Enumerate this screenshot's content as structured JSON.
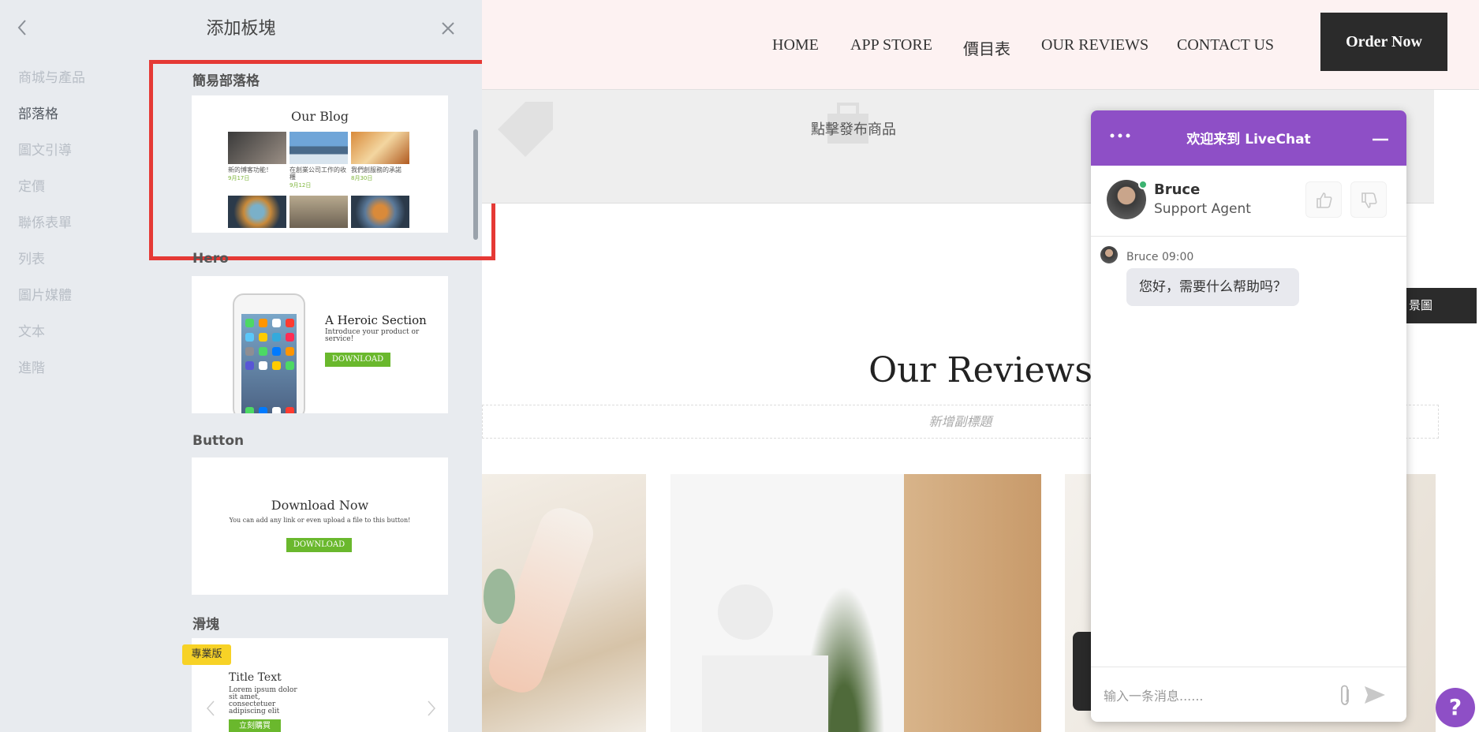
{
  "panel": {
    "title": "添加板塊",
    "categories": [
      "商城与產品",
      "部落格",
      "圖文引導",
      "定價",
      "聯係表單",
      "列表",
      "圖片媒體",
      "文本",
      "進階"
    ],
    "active_category": "部落格"
  },
  "blocks": {
    "blog": {
      "title": "簡易部落格",
      "preview_heading": "Our Blog",
      "captions": [
        "新的博客功能！",
        "在創業公司工作的收穫",
        "我們創服務的承諾"
      ],
      "dates": [
        "9月17日",
        "9月12日",
        "8月30日"
      ]
    },
    "hero": {
      "title": "Hero",
      "preview_heading": "A Heroic Section",
      "preview_sub": "Introduce your product or service!",
      "button": "DOWNLOAD"
    },
    "button": {
      "title": "Button",
      "preview_heading": "Download Now",
      "preview_sub": "You can add any link or even upload a file to this button!",
      "button": "DOWNLOAD"
    },
    "slider": {
      "title": "滑塊",
      "badge": "專業版",
      "preview_heading": "Title Text",
      "preview_sub": "Lorem ipsum dolor sit amet, consectetuer adipiscing elit",
      "button": "立刻購買"
    }
  },
  "nav": {
    "items": [
      "HOME",
      "APP STORE",
      "價目表",
      "OUR REVIEWS",
      "CONTACT US"
    ],
    "cta": "Order Now"
  },
  "page": {
    "product_placeholder": "點擊發布商品",
    "bg_button": "景圖",
    "section_title": "Our Reviews",
    "subtitle_placeholder": "新增副標題"
  },
  "chat": {
    "title": "欢迎来到 LiveChat",
    "agent_name": "Bruce",
    "agent_role": "Support Agent",
    "message_meta": "Bruce 09:00",
    "message": "您好，需要什么帮助吗？",
    "input_placeholder": "输入一条消息......",
    "help": "?"
  },
  "colors": {
    "chat_accent": "#8e4fc6",
    "highlight": "#e53935",
    "download_green": "#6ab82d",
    "pro_badge": "#f7d226"
  }
}
